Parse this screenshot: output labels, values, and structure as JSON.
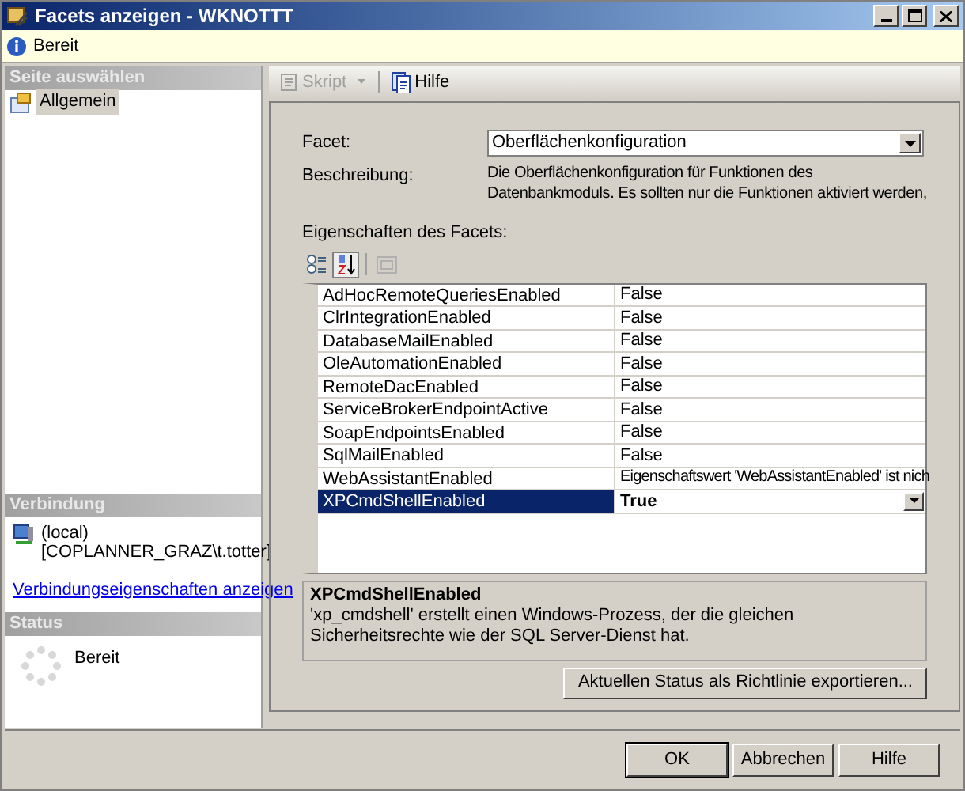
{
  "window": {
    "title": "Facets anzeigen - WKNOTTT"
  },
  "info_bar": {
    "text": "Bereit"
  },
  "sidebar": {
    "header": "Seite auswählen",
    "items": [
      {
        "label": "Allgemein",
        "selected": true
      }
    ],
    "connection": {
      "header": "Verbindung",
      "server": "(local)",
      "user": "[COPLANNER_GRAZ\\t.totter]",
      "link": "Verbindungseigenschaften anzeigen"
    },
    "status": {
      "header": "Status",
      "text": "Bereit"
    }
  },
  "toolbar": {
    "items": [
      {
        "kind": "script",
        "label": "Skript",
        "disabled": true
      },
      {
        "kind": "help",
        "label": "Hilfe",
        "disabled": false
      }
    ]
  },
  "facet": {
    "label": "Facet:",
    "value": "Oberflächenkonfiguration"
  },
  "description": {
    "label": "Beschreibung:",
    "lines": [
      "Die Oberflächenkonfiguration für Funktionen des",
      "Datenbankmoduls. Es sollten nur die Funktionen aktiviert werden,"
    ]
  },
  "properties": {
    "label": "Eigenschaften des Facets:",
    "sort_buttons": [
      {
        "kind": "categorized",
        "selected": false
      },
      {
        "kind": "alphabetical",
        "selected": true
      }
    ],
    "rows": [
      {
        "name": "AdHocRemoteQueriesEnabled",
        "value": "False",
        "selected": false
      },
      {
        "name": "ClrIntegrationEnabled",
        "value": "False",
        "selected": false
      },
      {
        "name": "DatabaseMailEnabled",
        "value": "False",
        "selected": false
      },
      {
        "name": "OleAutomationEnabled",
        "value": "False",
        "selected": false
      },
      {
        "name": "RemoteDacEnabled",
        "value": "False",
        "selected": false
      },
      {
        "name": "ServiceBrokerEndpointActive",
        "value": "False",
        "selected": false
      },
      {
        "name": "SoapEndpointsEnabled",
        "value": "False",
        "selected": false
      },
      {
        "name": "SqlMailEnabled",
        "value": "False",
        "selected": false
      },
      {
        "name": "WebAssistantEnabled",
        "value": "Eigenschaftswert 'WebAssistantEnabled' ist nich",
        "selected": false
      },
      {
        "name": "XPCmdShellEnabled",
        "value": "True",
        "selected": true
      }
    ]
  },
  "help_box": {
    "title": "XPCmdShellEnabled",
    "text": "'xp_cmdshell' erstellt einen Windows-Prozess, der die gleichen Sicherheitsrechte wie der SQL Server-Dienst hat."
  },
  "export_button": "Aktuellen Status als Richtlinie exportieren...",
  "buttons": [
    "OK",
    "Abbrechen",
    "Hilfe"
  ]
}
